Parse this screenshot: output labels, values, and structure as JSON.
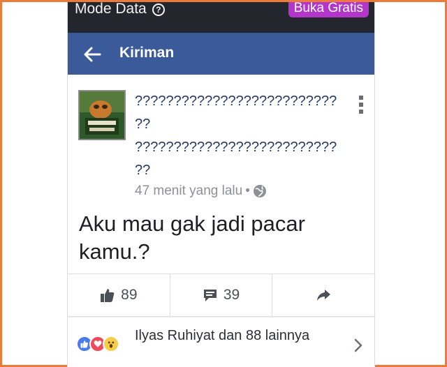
{
  "status_bar": {
    "mode_label": "Mode Data",
    "help_glyph": "?",
    "cta_label": "Buka Gratis"
  },
  "nav": {
    "title": "Kiriman",
    "back_icon": "arrow-left-icon"
  },
  "post": {
    "author_name": "?????????????????????????? ?? ?????????????????????????? ??",
    "timestamp": "47 menit yang lalu",
    "separator": "•",
    "privacy_icon": "globe-icon",
    "text": "Aku mau gak jadi pacar kamu.?"
  },
  "actions": {
    "like_count": "89",
    "comment_count": "39",
    "like_icon": "thumbs-up-icon",
    "comment_icon": "comment-icon",
    "share_icon": "share-arrow-icon"
  },
  "reactions": {
    "summary": "Ilyas Ruhiyat dan 88 lainnya",
    "icons": [
      "like-reaction-icon",
      "love-reaction-icon",
      "wow-reaction-icon"
    ]
  },
  "colors": {
    "nav_blue": "#3a5a9a",
    "status_bar": "#23262d",
    "cta_purple": "#b236c9",
    "border_orange": "#ec7a3a"
  }
}
